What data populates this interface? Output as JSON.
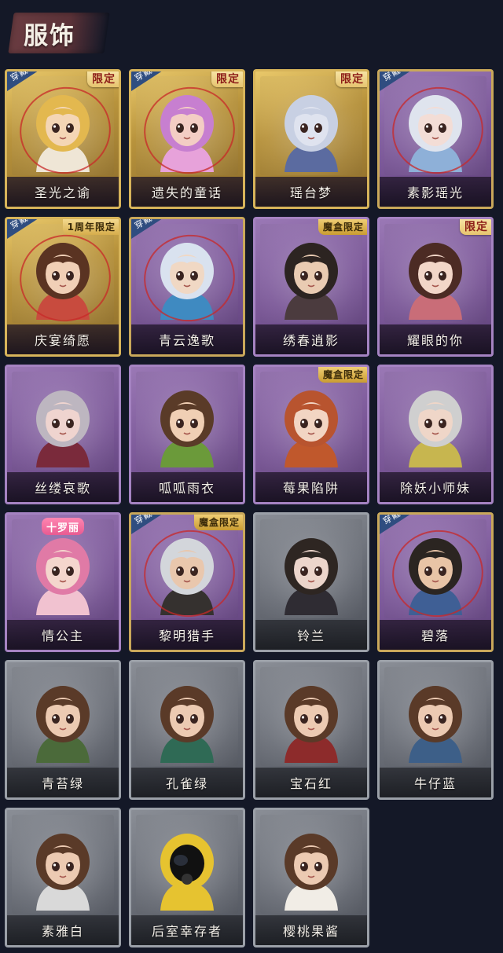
{
  "header": {
    "title": "服饰"
  },
  "colors": {
    "background": "#141827",
    "header_tag": "#5b3238",
    "wear_tag": "#2f4d80",
    "limited_text": "#8d1d18"
  },
  "labels": {
    "wear": "穿戴"
  },
  "cards": [
    {
      "name": "圣光之谕",
      "rarity": "gold",
      "badge": "限定",
      "badge_style": "limited",
      "worn": true,
      "skin": "#f4d6b5",
      "hair": "#e3b84f",
      "outfit": "#efe6d6"
    },
    {
      "name": "遗失的童话",
      "rarity": "gold",
      "badge": "限定",
      "badge_style": "limited",
      "worn": true,
      "skin": "#f3cdc4",
      "hair": "#c77fd0",
      "outfit": "#e7a2da"
    },
    {
      "name": "瑶台梦",
      "rarity": "gold",
      "badge": "限定",
      "badge_style": "limited",
      "worn": false,
      "skin": "#dfe3ef",
      "hair": "#c8d0e3",
      "outfit": "#5b6ba0"
    },
    {
      "name": "素影瑶光",
      "rarity": "purple-gold",
      "badge": "",
      "badge_style": "",
      "worn": true,
      "skin": "#f3ddd6",
      "hair": "#dfe4ee",
      "outfit": "#8eb0d8"
    },
    {
      "name": "庆宴绮愿",
      "rarity": "gold",
      "badge": "1周年限定",
      "badge_style": "anniv",
      "worn": true,
      "skin": "#f0cfb6",
      "hair": "#5a3322",
      "outfit": "#c84b3e"
    },
    {
      "name": "青云逸歌",
      "rarity": "purple-gold",
      "badge": "",
      "badge_style": "",
      "worn": true,
      "skin": "#f0d8c4",
      "hair": "#d9e2ef",
      "outfit": "#3f8ac1"
    },
    {
      "name": "绣春逍影",
      "rarity": "purple",
      "badge": "魔盒限定",
      "badge_style": "box-limited",
      "worn": false,
      "skin": "#e9cbb2",
      "hair": "#2c2421",
      "outfit": "#4b3b3e"
    },
    {
      "name": "耀眼的你",
      "rarity": "purple",
      "badge": "限定",
      "badge_style": "limited",
      "worn": false,
      "skin": "#f2d6c8",
      "hair": "#4c2b24",
      "outfit": "#c96d78"
    },
    {
      "name": "丝缕哀歌",
      "rarity": "purple",
      "badge": "",
      "badge_style": "",
      "worn": false,
      "skin": "#efd4cf",
      "hair": "#bdb6c0",
      "outfit": "#7a2a3b"
    },
    {
      "name": "呱呱雨衣",
      "rarity": "purple",
      "badge": "",
      "badge_style": "",
      "worn": false,
      "skin": "#f0cfb4",
      "hair": "#5a3b28",
      "outfit": "#6b9a3a"
    },
    {
      "name": "莓果陷阱",
      "rarity": "purple",
      "badge": "魔盒限定",
      "badge_style": "box-limited",
      "worn": false,
      "skin": "#f2d5c3",
      "hair": "#b8542f",
      "outfit": "#c0582c"
    },
    {
      "name": "除妖小师妹",
      "rarity": "purple",
      "badge": "",
      "badge_style": "",
      "worn": false,
      "skin": "#efd6c8",
      "hair": "#cfcfcf",
      "outfit": "#c7b64f"
    },
    {
      "name": "情公主",
      "rarity": "purple",
      "badge": "十罗丽",
      "badge_style": "pink",
      "worn": false,
      "skin": "#f4d6cd",
      "hair": "#e07aa6",
      "outfit": "#f1c2d0"
    },
    {
      "name": "黎明猎手",
      "rarity": "purple-gold",
      "badge": "魔盒限定",
      "badge_style": "box-limited",
      "worn": true,
      "skin": "#e9c7ad",
      "hair": "#d3d6db",
      "outfit": "#35312f"
    },
    {
      "name": "铃兰",
      "rarity": "grey",
      "badge": "",
      "badge_style": "",
      "worn": false,
      "skin": "#ecd5cb",
      "hair": "#2e2622",
      "outfit": "#2f2c33"
    },
    {
      "name": "碧落",
      "rarity": "purple-gold",
      "badge": "",
      "badge_style": "",
      "worn": true,
      "skin": "#e8c4a6",
      "hair": "#2b2521",
      "outfit": "#3f5f95"
    },
    {
      "name": "青苔绿",
      "rarity": "grey",
      "badge": "",
      "badge_style": "",
      "worn": false,
      "skin": "#eccab2",
      "hair": "#5a3a28",
      "outfit": "#4b6a3a"
    },
    {
      "name": "孔雀绿",
      "rarity": "grey",
      "badge": "",
      "badge_style": "",
      "worn": false,
      "skin": "#eccab2",
      "hair": "#5a3a28",
      "outfit": "#2f6a55"
    },
    {
      "name": "宝石红",
      "rarity": "grey",
      "badge": "",
      "badge_style": "",
      "worn": false,
      "skin": "#eccab2",
      "hair": "#5a3a28",
      "outfit": "#8d2b2b"
    },
    {
      "name": "牛仔蓝",
      "rarity": "grey",
      "badge": "",
      "badge_style": "",
      "worn": false,
      "skin": "#eccab2",
      "hair": "#5a3a28",
      "outfit": "#3d5f88"
    },
    {
      "name": "素雅白",
      "rarity": "grey",
      "badge": "",
      "badge_style": "",
      "worn": false,
      "skin": "#eccab2",
      "hair": "#5a3a28",
      "outfit": "#d9d9d9"
    },
    {
      "name": "后室幸存者",
      "rarity": "grey",
      "badge": "",
      "badge_style": "",
      "worn": false,
      "skin": "#1a1a1a",
      "hair": "#e6c330",
      "outfit": "#e6c330"
    },
    {
      "name": "樱桃果酱",
      "rarity": "grey",
      "badge": "",
      "badge_style": "",
      "worn": false,
      "skin": "#eccab2",
      "hair": "#5a3a28",
      "outfit": "#f1ede6"
    }
  ]
}
